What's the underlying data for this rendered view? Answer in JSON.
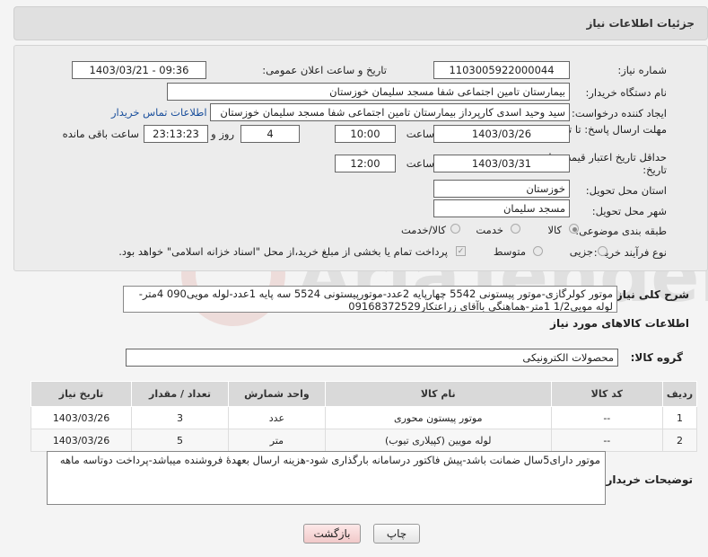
{
  "title": "جزئیات اطلاعات نیاز",
  "need_number": {
    "label": "شماره نیاز:",
    "value": "1103005922000044"
  },
  "announce": {
    "label": "تاریخ و ساعت اعلان عمومی:",
    "value": "1403/03/21 - 09:36"
  },
  "buyer_org": {
    "label": "نام دستگاه خریدار:",
    "value": "بیمارستان تامین اجتماعی شفا مسجد سلیمان خوزستان"
  },
  "requester": {
    "label": "ایجاد کننده درخواست:",
    "value": "سید وحید اسدی کارپرداز بیمارستان تامین اجتماعی شفا مسجد سلیمان خوزستان",
    "contact_link": "اطلاعات تماس خریدار"
  },
  "deadline": {
    "label": "مهلت ارسال پاسخ: تا تاریخ:",
    "date": "1403/03/26",
    "time_label": "ساعت",
    "time": "10:00",
    "days": "4",
    "days_label": "روز و",
    "remaining": "23:13:23",
    "remaining_label": "ساعت باقی مانده"
  },
  "validity": {
    "label": "حداقل تاریخ اعتبار قیمت: تا تاریخ:",
    "date": "1403/03/31",
    "time_label": "ساعت",
    "time": "12:00"
  },
  "province": {
    "label": "استان محل تحویل:",
    "value": "خوزستان"
  },
  "city": {
    "label": "شهر محل تحویل:",
    "value": "مسجد سلیمان"
  },
  "category": {
    "label": "طبقه بندی موضوعی:",
    "options": [
      "کالا",
      "خدمت",
      "کالا/خدمت"
    ],
    "selected": "کالا"
  },
  "purchase_type": {
    "label": "نوع فرآیند خرید :",
    "options": [
      "جزیی",
      "متوسط"
    ],
    "note": "پرداخت تمام یا بخشی از مبلغ خرید،از محل \"اسناد خزانه اسلامی\" خواهد بود."
  },
  "description": {
    "label": "شرح کلی نیاز:",
    "value": "موتور کولرگازی-موتور پیستونی 5542 چهارپایه 2عدد-موتورپیستونی 5524 سه پایه 1عدد-لوله مویی090 4متر-لوله مویی1/2 1متر-هماهنگی باآقای زراعتکار09168372529"
  },
  "goods_section_title": "اطلاعات کالاهای مورد نیاز",
  "goods_group": {
    "label": "گروه کالا:",
    "value": "محصولات الکترونیکی"
  },
  "table": {
    "headers": [
      "ردیف",
      "کد کالا",
      "نام کالا",
      "واحد شمارش",
      "تعداد / مقدار",
      "تاریخ نیاز"
    ],
    "rows": [
      [
        "1",
        "--",
        "موتور پیستون محوری",
        "عدد",
        "3",
        "1403/03/26"
      ],
      [
        "2",
        "--",
        "لوله مویین (کپیلاری تیوب)",
        "متر",
        "5",
        "1403/03/26"
      ]
    ]
  },
  "buyer_notes": {
    "label": "توضیحات خریدار:",
    "value": "موتور دارای5سال ضمانت باشد-پیش فاکتور درسامانه بارگذاری شود-هزینه ارسال بعهدهٔ فروشنده میباشد-پرداخت دوتاسه ماهه"
  },
  "buttons": {
    "print": "چاپ",
    "back": "بازگشت"
  },
  "colors": {
    "link": "#1a4f9c",
    "back_button_bg": "#f7d6d6"
  }
}
